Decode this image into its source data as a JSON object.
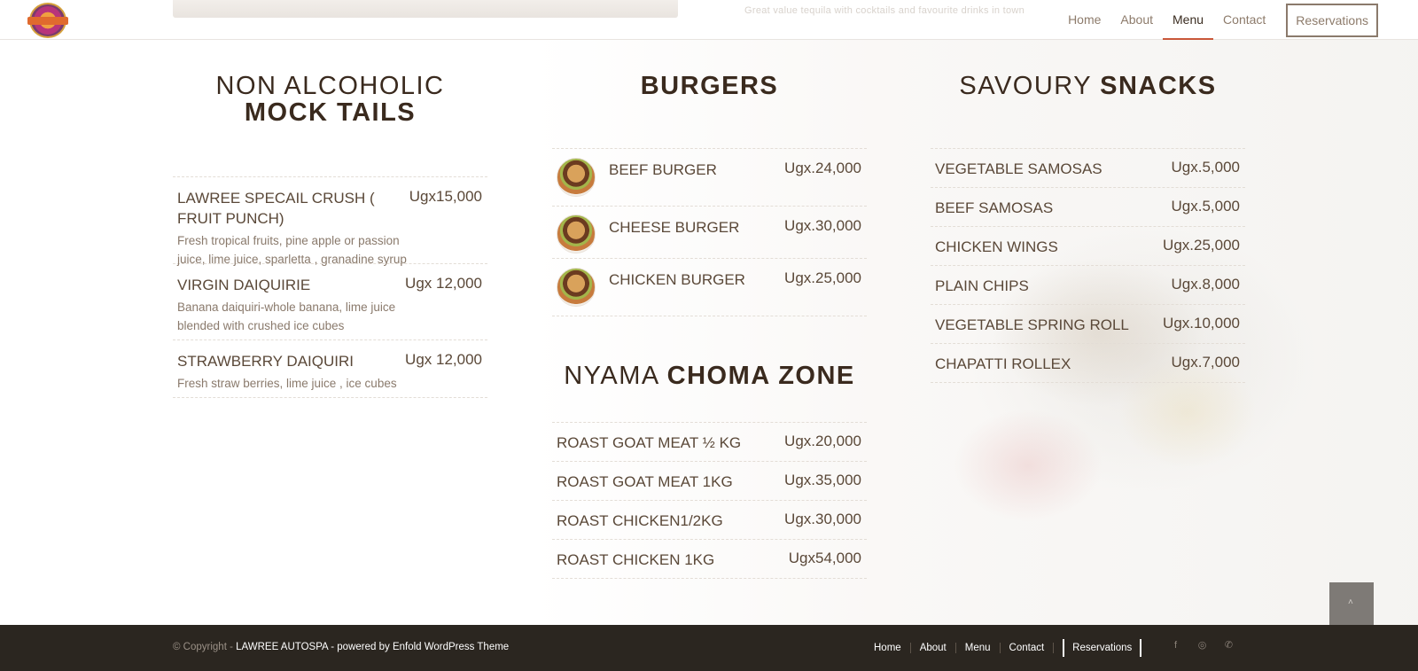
{
  "header": {
    "top_faint_text": "Great value tequila with cocktails and favourite drinks in town",
    "nav": [
      {
        "label": "Home",
        "active": false
      },
      {
        "label": "About",
        "active": false
      },
      {
        "label": "Menu",
        "active": true
      },
      {
        "label": "Contact",
        "active": false
      }
    ],
    "reservations_label": "Reservations"
  },
  "mocktails": {
    "title_light": "NON ALCOHOLIC",
    "title_bold": "MOCK TAILS",
    "items": [
      {
        "name": "LAWREE SPECAIL CRUSH ( FRUIT PUNCH)",
        "price": "Ugx15,000",
        "desc": "Fresh tropical fruits, pine apple or passion juice, lime juice, sparletta , granadine syrup"
      },
      {
        "name": "VIRGIN DAIQUIRIE",
        "price": "Ugx 12,000",
        "desc": "Banana daiquiri-whole banana, lime juice blended with crushed ice cubes"
      },
      {
        "name": "STRAWBERRY DAIQUIRI",
        "price": "Ugx 12,000",
        "desc": "Fresh straw berries, lime juice , ice cubes"
      }
    ]
  },
  "burgers": {
    "title_bold": "BURGERS",
    "items": [
      {
        "name": "BEEF BURGER",
        "price": "Ugx.24,000"
      },
      {
        "name": "CHEESE BURGER",
        "price": "Ugx.30,000"
      },
      {
        "name": "CHICKEN BURGER",
        "price": "Ugx.25,000"
      }
    ]
  },
  "choma": {
    "title_light": "NYAMA",
    "title_bold": "CHOMA ZONE",
    "items": [
      {
        "name": "ROAST GOAT MEAT ½ KG",
        "price": "Ugx.20,000"
      },
      {
        "name": "ROAST GOAT MEAT 1KG",
        "price": "Ugx.35,000"
      },
      {
        "name": "ROAST CHICKEN1/2KG",
        "price": "Ugx.30,000"
      },
      {
        "name": "ROAST CHICKEN 1KG",
        "price": "Ugx54,000"
      }
    ]
  },
  "snacks": {
    "title_light": "SAVOURY",
    "title_bold": "SNACKS",
    "items": [
      {
        "name": "VEGETABLE SAMOSAS",
        "price": "Ugx.5,000"
      },
      {
        "name": "BEEF SAMOSAS",
        "price": "Ugx.5,000"
      },
      {
        "name": "CHICKEN WINGS",
        "price": "Ugx.25,000"
      },
      {
        "name": "PLAIN CHIPS",
        "price": "Ugx.8,000"
      },
      {
        "name": "VEGETABLE SPRING ROLL",
        "price": "Ugx.10,000"
      },
      {
        "name": "CHAPATTI ROLLEX",
        "price": "Ugx.7,000"
      }
    ]
  },
  "footer": {
    "copyright_prefix": "© Copyright - ",
    "copyright_brand": "LAWREE AUTOSPA - powered by Enfold WordPress Theme",
    "nav": [
      "Home",
      "About",
      "Menu",
      "Contact"
    ],
    "reservations_label": "Reservations",
    "socials": [
      {
        "icon": "facebook-icon",
        "glyph": "f"
      },
      {
        "icon": "instagram-icon",
        "glyph": "◎"
      },
      {
        "icon": "whatsapp-icon",
        "glyph": "✆"
      }
    ]
  },
  "scroll_top": {
    "glyph": "˄"
  }
}
